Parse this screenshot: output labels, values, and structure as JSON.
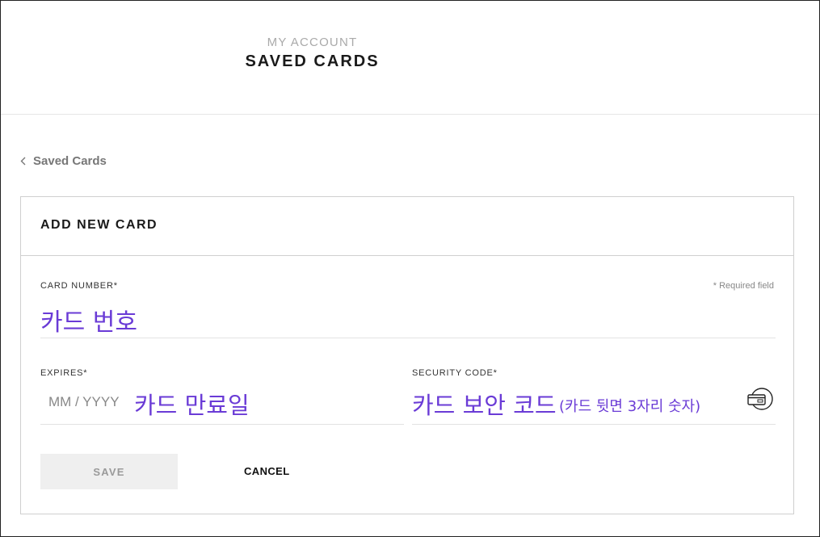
{
  "header": {
    "eyebrow": "MY ACCOUNT",
    "title": "SAVED CARDS"
  },
  "breadcrumb": {
    "back_label": "Saved Cards",
    "icon": "chevron-left-icon"
  },
  "form": {
    "title": "ADD NEW CARD",
    "required_note": "* Required field",
    "card_number": {
      "label": "CARD NUMBER*",
      "value_annotation": "카드 번호"
    },
    "expires": {
      "label": "EXPIRES*",
      "placeholder": "MM / YYYY",
      "value_annotation": "카드 만료일"
    },
    "security_code": {
      "label": "SECURITY CODE*",
      "value_annotation": "카드 보안 코드",
      "hint_annotation": "(카드 뒷면 3자리 숫자)",
      "icon": "credit-card-cvv-icon"
    },
    "save_label": "SAVE",
    "cancel_label": "CANCEL"
  },
  "colors": {
    "annotation": "#6a3bd6",
    "save_bg": "#efefef",
    "border": "#cfcfcf"
  }
}
